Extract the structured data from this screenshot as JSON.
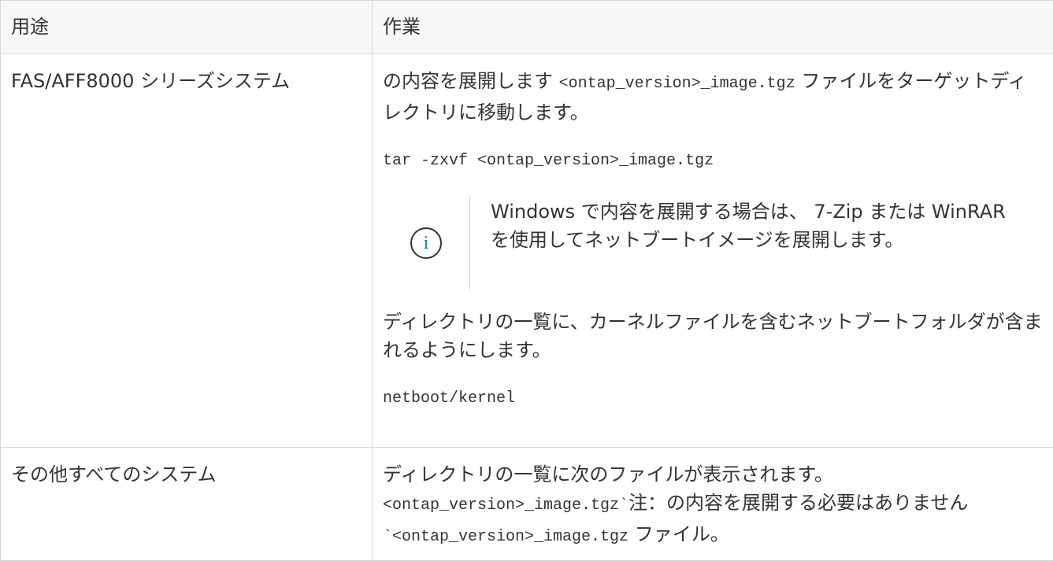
{
  "table": {
    "headers": [
      "用途",
      "作業"
    ],
    "rows": [
      {
        "use": "FAS/AFF8000 シリーズシステム",
        "task": {
          "para1_prefix": "の内容を展開します ",
          "para1_code": "<ontap_version>_image.tgz",
          "para1_suffix": " ファイルをターゲットディレクトリに移動します。",
          "code1": "tar -zxvf <ontap_version>_image.tgz",
          "note": {
            "icon": "info-icon",
            "text": "Windows で内容を展開する場合は、 7-Zip または WinRAR を使用してネットブートイメージを展開します。"
          },
          "para2": "ディレクトリの一覧に、カーネルファイルを含むネットブートフォルダが含まれるようにします。",
          "code2": "netboot/kernel"
        }
      },
      {
        "use": "その他すべてのシステム",
        "task": {
          "line1": "ディレクトリの一覧に次のファイルが表示されます。",
          "code_a": "<ontap_version>_image.tgz`",
          "mid": "注：の内容を展開する必要はありません ",
          "code_b": "`<ontap_version>_image.tgz",
          "suffix": " ファイル。"
        }
      }
    ]
  }
}
